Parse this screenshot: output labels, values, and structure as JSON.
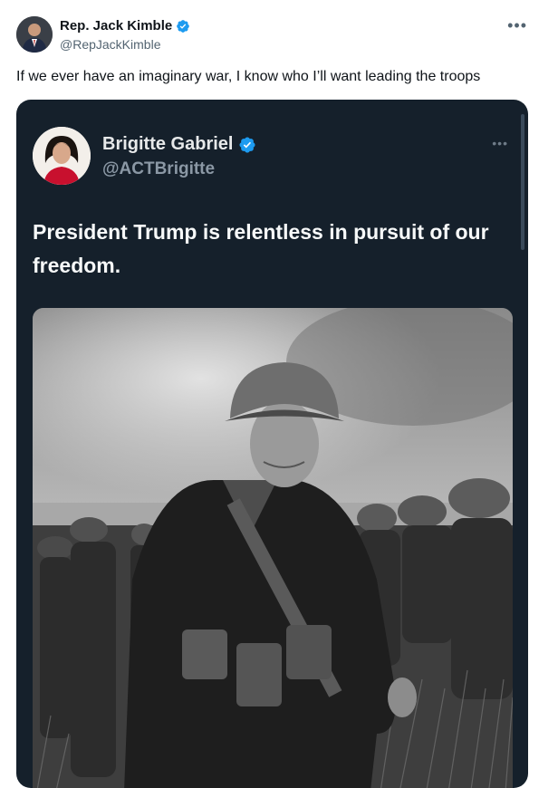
{
  "tweet": {
    "author": {
      "display_name": "Rep. Jack Kimble",
      "handle": "@RepJackKimble",
      "verified": true
    },
    "text": "If we ever have an imaginary war, I know who I’ll want leading the troops",
    "more_icon": "more-horizontal-icon"
  },
  "quoted": {
    "author": {
      "display_name": "Brigitte Gabriel",
      "handle": "@ACTBrigitte",
      "verified": true
    },
    "text": "President Trump is relentless in pursuit of our freedom.",
    "more_icon": "more-horizontal-icon"
  },
  "colors": {
    "verified_blue": "#1d9bf0",
    "dark_bg": "#15202b"
  }
}
